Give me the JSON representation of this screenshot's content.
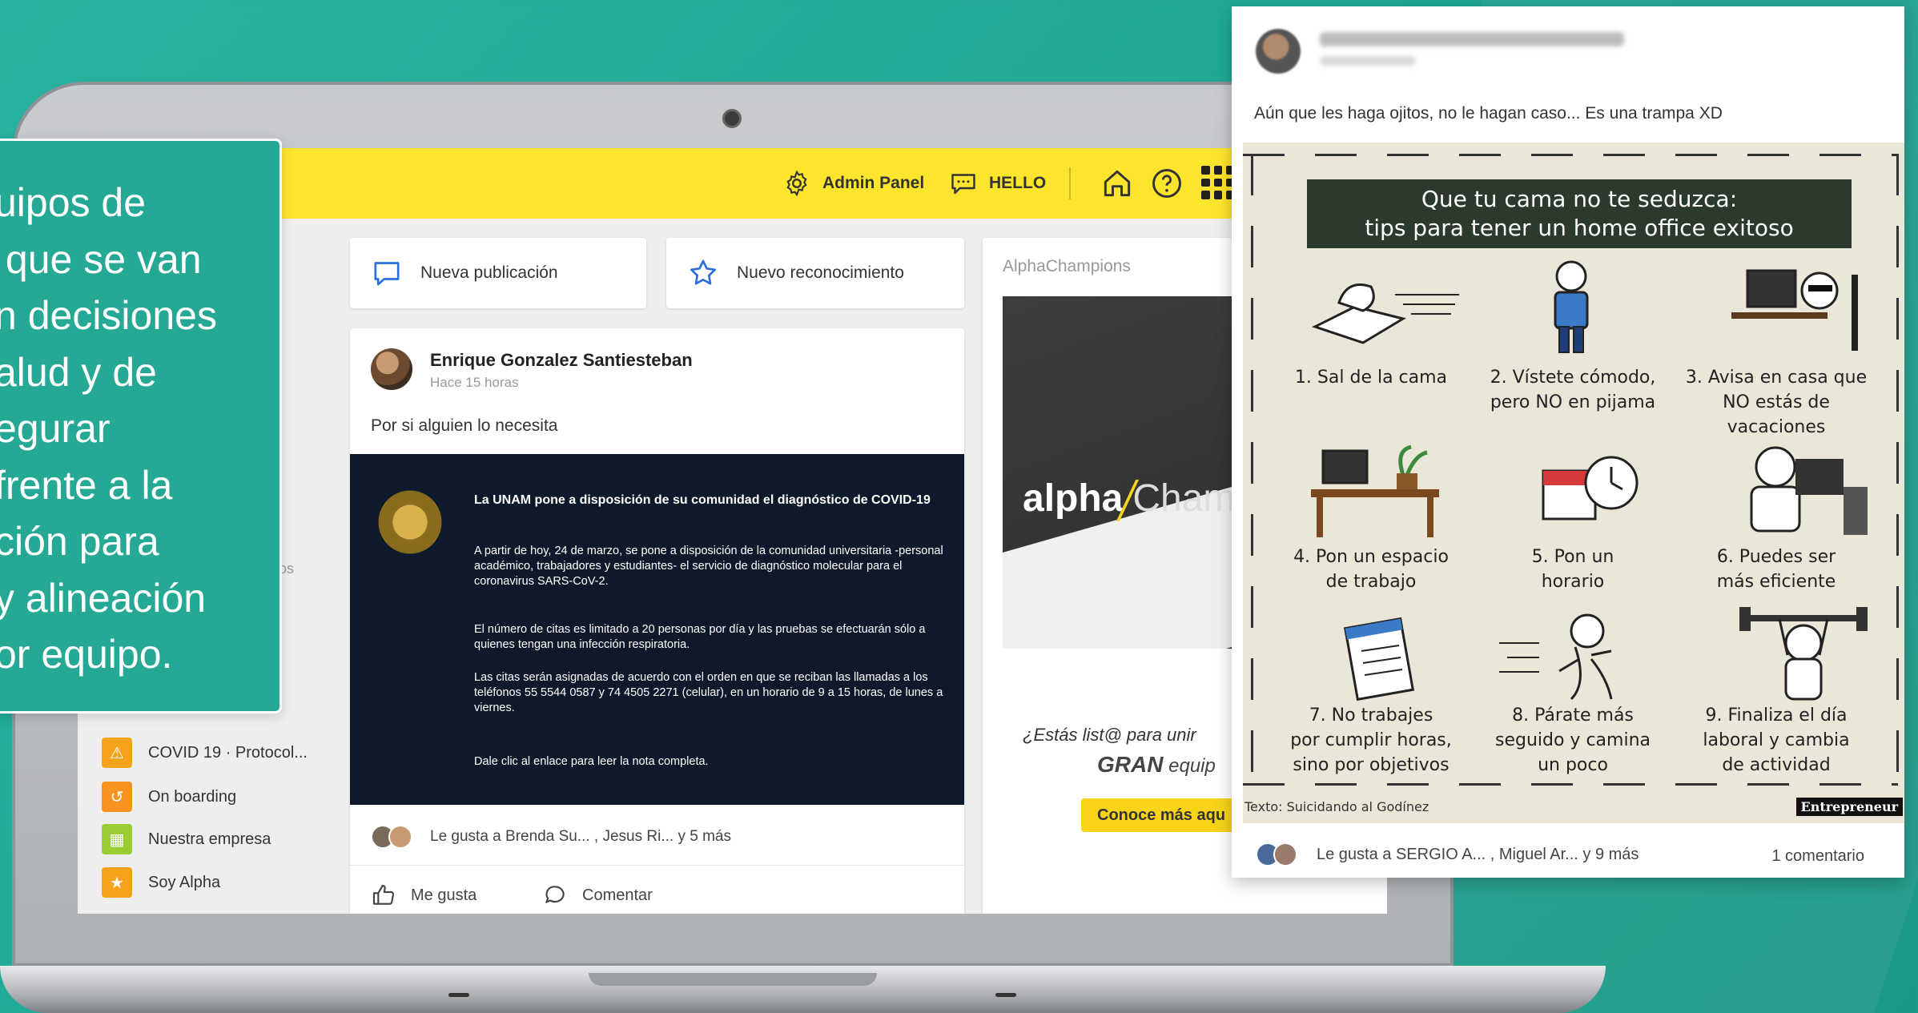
{
  "callout": {
    "text": "uipos de\n que se van\nn decisiones\nalud y de\negurar\nfrente a la\nción para\ny alineación\nor equipo."
  },
  "topbar": {
    "admin_panel_label": "Admin Panel",
    "hello_label": "HELLO",
    "icons": [
      "gear-icon",
      "chat-icon",
      "home-icon",
      "help-icon",
      "apps-grid-icon"
    ]
  },
  "sidebar": {
    "fragment_text": "los",
    "items": [
      {
        "label": "COVID 19 · Protocol...",
        "color": "#f7a21b"
      },
      {
        "label": "On boarding",
        "color": "#f7931e"
      },
      {
        "label": "Nuestra empresa",
        "color": "#9acd32"
      },
      {
        "label": "Soy Alpha",
        "color": "#f7a21b"
      }
    ]
  },
  "actions": {
    "new_post_label": "Nueva publicación",
    "new_recognition_label": "Nuevo reconocimiento"
  },
  "post": {
    "author": "Enrique Gonzalez Santiesteban",
    "time": "Hace 15 horas",
    "text": "Por si alguien lo necesita",
    "image": {
      "title": "La UNAM pone a disposición de su comunidad el diagnóstico de COVID-19",
      "p1": "A partir de hoy, 24 de marzo, se pone a disposición de la comunidad universitaria -personal académico, trabajadores y estudiantes- el servicio de diagnóstico molecular para el coronavirus SARS-CoV-2.",
      "p2": "El número de citas es limitado a 20 personas por día y las pruebas se efectuarán sólo a quienes tengan una infección respiratoria.",
      "p3": "Las citas serán asignadas de acuerdo con el orden en que se reciban las llamadas a los teléfonos 55 5544 0587 y 74 4505 2271 (celular), en un horario de 9 a 15 horas, de lunes a viernes.",
      "p4": "Dale clic al enlace para leer la nota completa."
    },
    "likes_text": "Le gusta a Brenda Su... , Jesus Ri...  y 5 más",
    "like_label": "Me gusta",
    "comment_label": "Comentar"
  },
  "alpha_card": {
    "title": "AlphaChampions",
    "logo_bold": "alpha",
    "logo_thin": "Champ",
    "question_1": "¿Estás list@ para unir",
    "question_2_bold": "GRAN",
    "question_2_rest": " equip",
    "button_label": "Conoce más aqu"
  },
  "floating_post": {
    "caption": "Aún que les haga ojitos, no le hagan caso... Es una trampa XD",
    "poster_title_line1": "Que tu cama no te seduzca:",
    "poster_title_line2": "tips para tener un home office exitoso",
    "tips": [
      "1. Sal de la cama",
      "2. Vístete cómodo,\npero NO en pijama",
      "3. Avisa en casa que\nNO estás de\nvacaciones",
      "4. Pon un espacio\nde trabajo",
      "5. Pon un\nhorario",
      "6. Puedes ser\nmás eficiente",
      "7. No trabajes\npor cumplir horas,\nsino por objetivos",
      "8. Párate más\nseguido y camina\nun poco",
      "9. Finaliza el día\nlaboral y cambia\nde actividad"
    ],
    "credit": "Texto: Suicidando al Godínez",
    "brand": "Entrepreneur",
    "likes_text": "Le gusta a SERGIO A... , Miguel Ar... y 9 más",
    "comments_text": "1 comentario"
  },
  "colors": {
    "background": "#25ae9a",
    "topbar": "#fde52d",
    "accent_blue": "#2a6fdb",
    "poster_bg": "#eae6d8"
  }
}
